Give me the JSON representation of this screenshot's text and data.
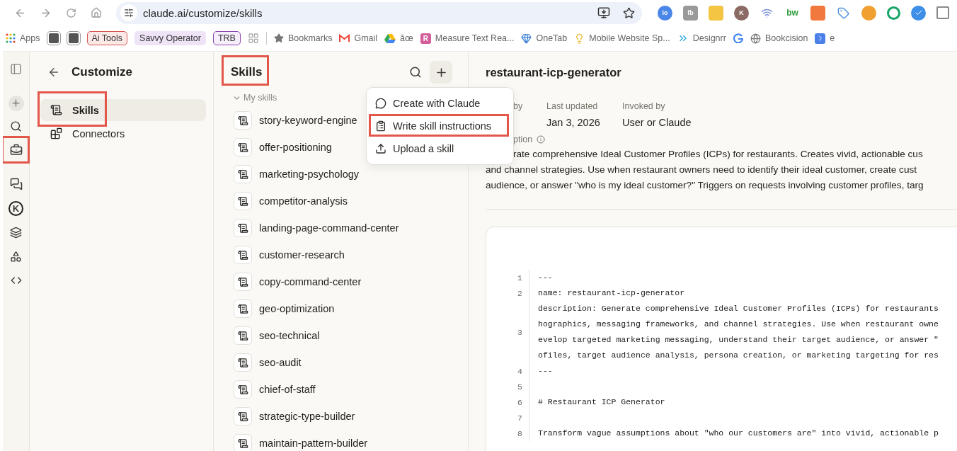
{
  "browser": {
    "url": "claude.ai/customize/skills",
    "extensions": [
      {
        "kind": "circle",
        "color": "#4a86e8",
        "glyph": "io"
      },
      {
        "kind": "square",
        "color": "#9a9a9a",
        "glyph": "fb"
      },
      {
        "kind": "square",
        "color": "#f4c542"
      },
      {
        "kind": "circle",
        "color": "#8a6a62",
        "glyph": "K"
      },
      {
        "kind": "signal",
        "color": "#7a8fd8"
      },
      {
        "kind": "text",
        "color": "#2e9b3a",
        "glyph": "bw"
      },
      {
        "kind": "square",
        "color": "#f2793d"
      },
      {
        "kind": "tag",
        "color": "#4a90e2"
      },
      {
        "kind": "circle",
        "color": "#f0a030"
      },
      {
        "kind": "ring",
        "color": "#15a467"
      },
      {
        "kind": "check",
        "color": "#3d8fe8"
      },
      {
        "kind": "paper",
        "color": "#8a8a8a"
      }
    ]
  },
  "bookmarks": [
    {
      "kind": "apps",
      "label": "Apps"
    },
    {
      "kind": "square"
    },
    {
      "kind": "square"
    },
    {
      "kind": "chip",
      "label": "Ai Tools",
      "color": "#d9534f"
    },
    {
      "kind": "chip",
      "label": "Savvy Operator",
      "color": "#efe3f7"
    },
    {
      "kind": "chip",
      "label": "TRB",
      "color": "#8e44ad"
    },
    {
      "kind": "grid"
    },
    {
      "kind": "star",
      "label": "Bookmarks"
    },
    {
      "kind": "mail",
      "label": "Gmail"
    },
    {
      "kind": "drive",
      "label": "ãœ"
    },
    {
      "kind": "letter",
      "glyph": "R",
      "label": "Measure Text Rea..."
    },
    {
      "kind": "gem",
      "label": "OneTab"
    },
    {
      "kind": "bulb",
      "label": "Mobile Website Sp..."
    },
    {
      "kind": "chevrons",
      "label": "Designrr"
    },
    {
      "kind": "google"
    },
    {
      "kind": "globe",
      "label": "Bookcision"
    },
    {
      "kind": "arrow",
      "label": "e"
    }
  ],
  "rail": {
    "k_glyph": "K",
    "items": [
      {
        "annotated": false
      },
      {
        "annotated": false
      },
      {
        "annotated": false
      },
      {
        "annotated": true
      },
      {
        "annotated": false
      },
      {
        "annotated": false
      },
      {
        "annotated": false
      },
      {
        "annotated": false
      },
      {
        "annotated": false
      }
    ]
  },
  "nav": {
    "title": "Customize",
    "items": [
      {
        "label": "Skills",
        "selected": true,
        "annotated": true
      },
      {
        "label": "Connectors",
        "selected": false,
        "annotated": false
      }
    ]
  },
  "skills_panel": {
    "title": "Skills",
    "annotated": true,
    "group": {
      "label": "My skills",
      "expanded": true
    },
    "items": [
      "story-keyword-engine",
      "offer-positioning",
      "marketing-psychology",
      "competitor-analysis",
      "landing-page-command-center",
      "customer-research",
      "copy-command-center",
      "geo-optimization",
      "seo-technical",
      "seo-audit",
      "chief-of-staff",
      "strategic-type-builder",
      "maintain-pattern-builder"
    ]
  },
  "menu": {
    "items": [
      {
        "label": "Create with Claude",
        "annotated": false
      },
      {
        "label": "Write skill instructions",
        "annotated": true
      },
      {
        "label": "Upload a skill",
        "annotated": false
      }
    ]
  },
  "detail": {
    "title": "restaurant-icp-generator",
    "meta": [
      {
        "label": "by"
      },
      {
        "label": "Last updated",
        "value": "Jan 3, 2026"
      },
      {
        "label": "Invoked by",
        "value": "User or Claude"
      }
    ],
    "description_label": "ption",
    "description_lines": [
      "rate comprehensive Ideal Customer Profiles (ICPs) for restaurants. Creates vivid, actionable cus",
      "and channel strategies. Use when restaurant owners need to identify their ideal customer, create cust",
      "audience, or answer \"who is my ideal customer?\" Triggers on requests involving customer profiles, targ"
    ],
    "code": [
      {
        "number": "1",
        "lines": [
          "---"
        ]
      },
      {
        "number": "2",
        "lines": [
          "name: restaurant-icp-generator"
        ]
      },
      {
        "number": "3",
        "lines": [
          "description: Generate comprehensive Ideal Customer Profiles (ICPs) for restaurants",
          "hographics, messaging frameworks, and channel strategies. Use when restaurant owne",
          "evelop targeted marketing messaging, understand their target audience, or answer \"",
          "ofiles, target audience analysis, persona creation, or marketing targeting for res"
        ]
      },
      {
        "number": "4",
        "lines": [
          "---"
        ]
      },
      {
        "number": "5"
      },
      {
        "number": "6",
        "lines": [
          "# Restaurant ICP Generator"
        ]
      },
      {
        "number": "7"
      },
      {
        "number": "8",
        "lines": [
          "Transform vague assumptions about \"who our customers are\" into vivid, actionable p"
        ]
      }
    ]
  }
}
